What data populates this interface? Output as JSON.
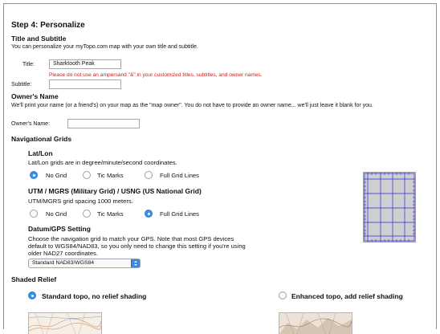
{
  "step": {
    "title": "Step 4: Personalize"
  },
  "title_subtitle": {
    "heading": "Title and Subtitle",
    "description": "You can personalize your myTopo.com map with your own title and subtitle.",
    "title_label": "Title:",
    "title_value": "Sharktooth Peak",
    "warning": "Please do not use an ampersand \"&\" in your customized titles, subtitles, and owner names.",
    "subtitle_label": "Subtitle:",
    "subtitle_value": ""
  },
  "owner": {
    "heading": "Owner's Name",
    "description": "We'll print your name (or a friend's) on your map as the \"map owner\". You do not have to provide an owner name... we'll just leave it blank for you.",
    "label": "Owner's Name:",
    "value": ""
  },
  "nav_grids": {
    "heading": "Navigational Grids",
    "latlon": {
      "heading": "Lat/Lon",
      "description": "Lat/Lon grids are in degree/minute/second coordinates.",
      "options": [
        "No Grid",
        "Tic Marks",
        "Full Grid Lines"
      ],
      "selected_index": 0
    },
    "utm": {
      "heading": "UTM / MGRS (Military Grid) / USNG (US National Grid)",
      "description": "UTM/MGRS grid spacing 1000 meters.",
      "options": [
        "No Grid",
        "Tic Marks",
        "Full Grid Lines"
      ],
      "selected_index": 2
    },
    "datum": {
      "heading": "Datum/GPS Setting",
      "description_line1": "Choose the navigation grid to match your GPS. Note that most GPS devices",
      "description_line2": "default to WGS84/NAD83, so you only need to change this setting if you're using",
      "description_line3": "older NAD27 coordinates.",
      "selected": "Standard NAD83/WGS84"
    }
  },
  "shaded_relief": {
    "heading": "Shaded Relief",
    "options": [
      "Standard topo, no relief shading",
      "Enhanced topo, add relief shading"
    ],
    "selected_index": 0
  },
  "colors": {
    "accent": "#3c8ee6",
    "warning": "#c81d1d",
    "grid_lines": "#2b2bd6"
  }
}
